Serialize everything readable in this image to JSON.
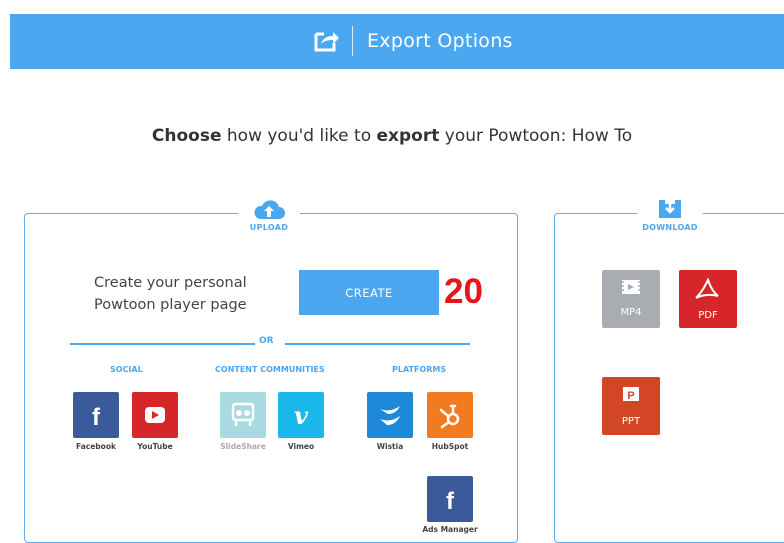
{
  "header": {
    "title": "Export Options",
    "icon": "share-icon"
  },
  "headline": {
    "bold1": "Choose",
    "text1": " how you'd like to ",
    "bold2": "export",
    "text2": " your Powtoon: How To"
  },
  "upload": {
    "label": "UPLOAD",
    "create_line1": "Create your personal",
    "create_line2": "Powtoon player page",
    "create_button": "CREATE",
    "or": "OR",
    "categories": {
      "social": "SOCIAL",
      "content": "CONTENT COMMUNITIES",
      "platforms": "PLATFORMS"
    },
    "services": {
      "facebook": "Facebook",
      "youtube": "YouTube",
      "slideshare": "SlideShare",
      "vimeo": "Vimeo",
      "wistia": "Wistia",
      "hubspot": "HubSpot",
      "ads_manager": "Ads Manager"
    }
  },
  "download": {
    "label": "DOWNLOAD",
    "formats": {
      "mp4": "MP4",
      "pdf": "PDF",
      "ppt": "PPT"
    }
  },
  "annotation": {
    "marker": "20"
  },
  "colors": {
    "accent": "#4aa7f0",
    "facebook": "#3b5a9a",
    "youtube": "#d6262a",
    "slideshare": "#a8dbe0",
    "vimeo": "#1ab7ea",
    "wistia": "#1f89d9",
    "hubspot": "#f27b22",
    "mp4": "#a9acb0",
    "pdf": "#d6262a",
    "ppt": "#d24625",
    "marker": "#e8141a"
  }
}
